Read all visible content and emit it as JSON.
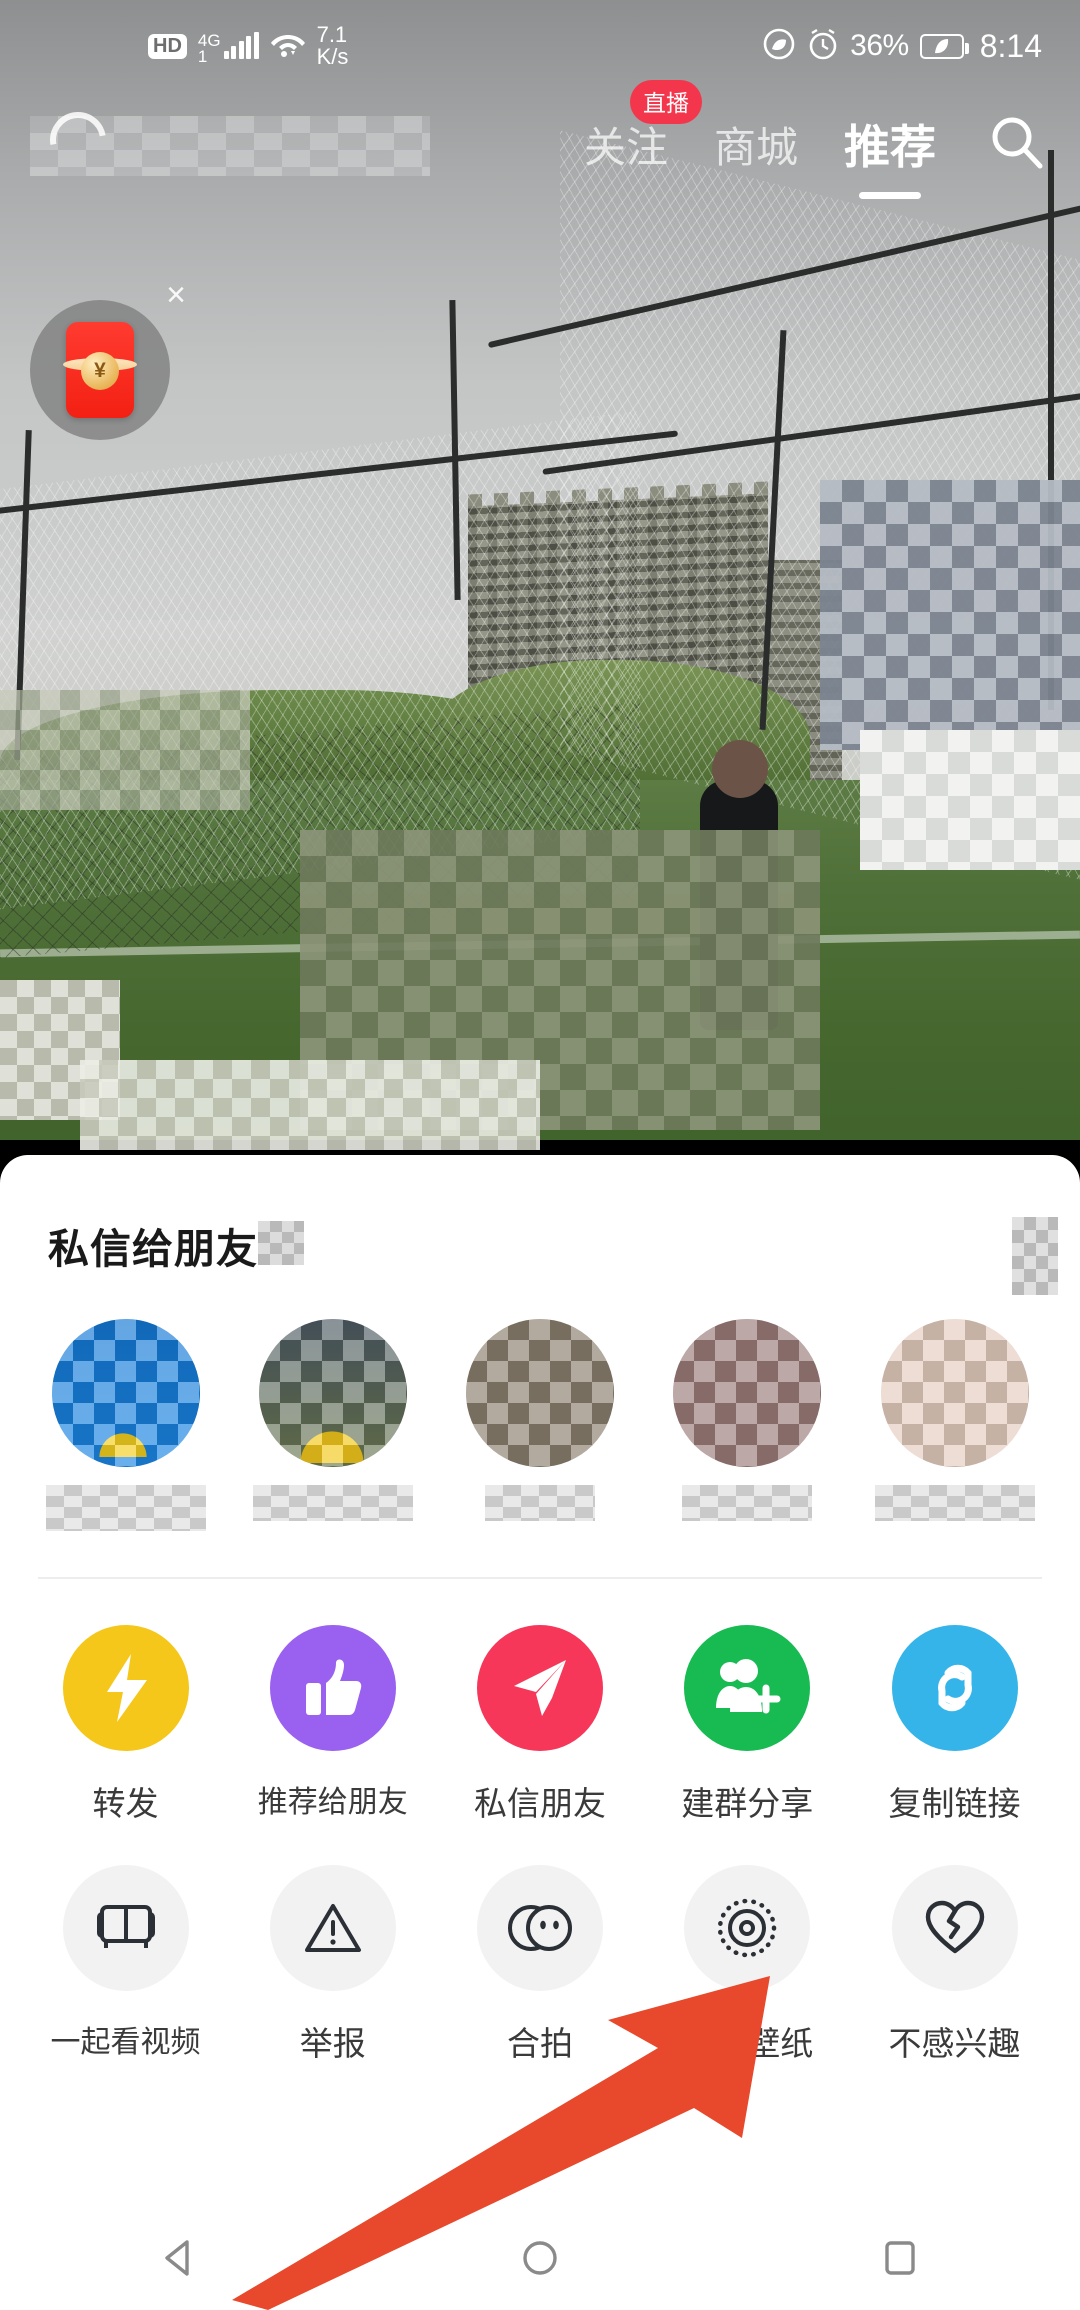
{
  "status_bar": {
    "hd_label": "HD",
    "network_label_top": "4G",
    "network_label_bottom": "1",
    "speed_value": "7.1",
    "speed_unit": "K/s",
    "battery_percent": "36%",
    "clock": "8:14",
    "icons": [
      "hd-icon",
      "signal-icon",
      "wifi-icon",
      "eye-care-icon",
      "alarm-icon",
      "battery-icon"
    ]
  },
  "top_nav": {
    "tabs": [
      {
        "label": "关注",
        "active": false,
        "badge": "直播"
      },
      {
        "label": "商城",
        "active": false,
        "badge": ""
      },
      {
        "label": "推荐",
        "active": true,
        "badge": ""
      }
    ],
    "search_icon": "search-icon"
  },
  "red_packet": {
    "currency_symbol": "¥",
    "close_label": "×"
  },
  "share_sheet": {
    "title": "私信给朋友",
    "friends": [
      {
        "name_redacted": true
      },
      {
        "name_redacted": true
      },
      {
        "name_redacted": true
      },
      {
        "name_redacted": true
      },
      {
        "name_redacted": true
      }
    ],
    "actions_row_1": [
      {
        "label": "转发",
        "icon": "lightning-icon",
        "color": "#F5C71A"
      },
      {
        "label": "推荐给朋友",
        "icon": "thumbs-up-icon",
        "color": "#9A61F0"
      },
      {
        "label": "私信朋友",
        "icon": "paper-plane-icon",
        "color": "#F6375A"
      },
      {
        "label": "建群分享",
        "icon": "add-person-icon",
        "color": "#18BA52"
      },
      {
        "label": "复制链接",
        "icon": "link-icon",
        "color": "#35B4EA"
      }
    ],
    "actions_row_2": [
      {
        "label": "一起看视频",
        "icon": "sofa-icon",
        "color": "#F2F2F2"
      },
      {
        "label": "举报",
        "icon": "warning-triangle-icon",
        "color": "#F2F2F2"
      },
      {
        "label": "合拍",
        "icon": "duet-faces-icon",
        "color": "#F2F2F2"
      },
      {
        "label": "动态壁纸",
        "icon": "live-wallpaper-icon",
        "color": "#F2F2F2"
      },
      {
        "label": "不感兴趣",
        "icon": "broken-heart-icon",
        "color": "#F2F2F2"
      }
    ]
  },
  "android_nav": {
    "back_icon": "back-triangle-icon",
    "home_icon": "home-circle-icon",
    "recents_icon": "recents-square-icon"
  },
  "annotation": {
    "arrow_color": "#E8482B",
    "points_to": "动态壁纸"
  }
}
